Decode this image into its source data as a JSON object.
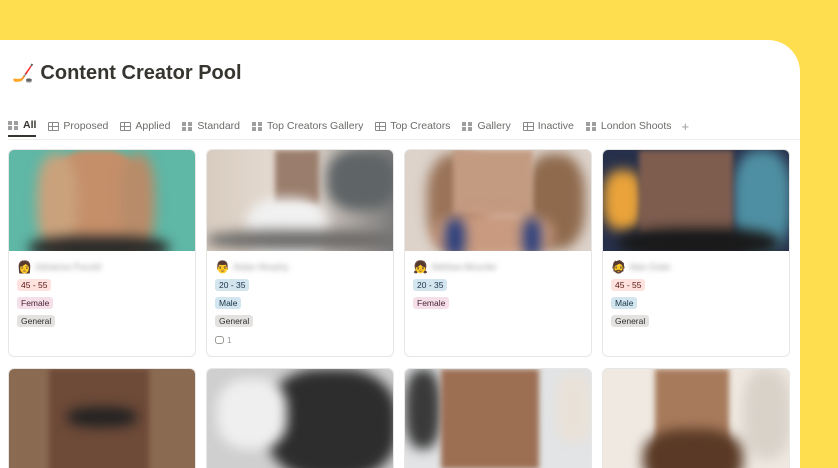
{
  "page": {
    "title_emoji": "🏒",
    "title": "Content Creator Pool"
  },
  "tabs": [
    {
      "label": "All",
      "icon": "gallery-icon",
      "active": true
    },
    {
      "label": "Proposed",
      "icon": "table-icon"
    },
    {
      "label": "Applied",
      "icon": "table-icon"
    },
    {
      "label": "Standard",
      "icon": "gallery-icon"
    },
    {
      "label": "Top Creators Gallery",
      "icon": "gallery-icon"
    },
    {
      "label": "Top Creators",
      "icon": "table-icon"
    },
    {
      "label": "Gallery",
      "icon": "gallery-icon"
    },
    {
      "label": "Inactive",
      "icon": "table-icon"
    },
    {
      "label": "London Shoots",
      "icon": "gallery-icon"
    }
  ],
  "add_view_symbol": "+",
  "cards": [
    {
      "emoji": "👩",
      "name": "Adrianne Purcell",
      "age": "45 - 55",
      "gender": "Female",
      "category": "General",
      "comments": ""
    },
    {
      "emoji": "👨",
      "name": "Aidan Murphy",
      "age": "20 - 35",
      "gender": "Male",
      "category": "General",
      "comments": "1"
    },
    {
      "emoji": "👧",
      "name": "Alethea Mounter",
      "age": "20 - 35",
      "gender": "Female",
      "category": "",
      "comments": ""
    },
    {
      "emoji": "🧔",
      "name": "Alan Duke",
      "age": "45 - 55",
      "gender": "Male",
      "category": "General",
      "comments": ""
    }
  ],
  "colors": {
    "background": "#FEDE4F",
    "tag_age_pink": "#fde2dd",
    "tag_age_blue": "#d3e5ef",
    "tag_female": "#f5e0e9",
    "tag_male": "#d3e5ef",
    "tag_general": "#e3e2e0"
  }
}
